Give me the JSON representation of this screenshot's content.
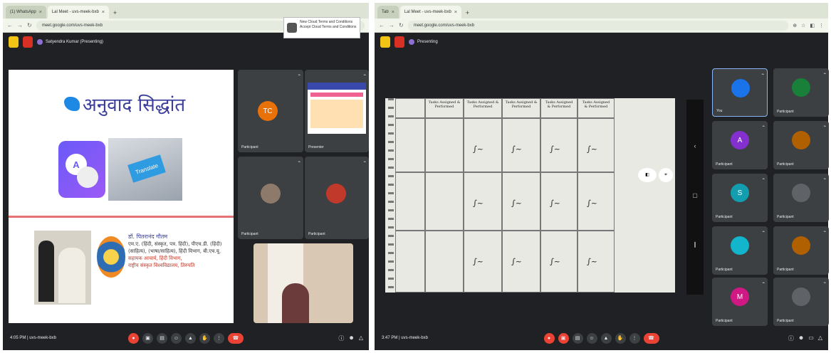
{
  "left": {
    "tabs": [
      {
        "label": "(1) WhatsApp",
        "active": false
      },
      {
        "label": "Lal Meet - uvs-meek-bxb",
        "active": true
      }
    ],
    "url": "meet.google.com/uvs-meek-bxb",
    "notification": {
      "title": "New Cloud Terms and Conditions",
      "body": "Accept Cloud Terms and Conditions"
    },
    "presenter": "Satyendra Kumar (Presenting)",
    "slide": {
      "title": "अनुवाद सिद्धांत",
      "translate_label": "Translate",
      "translate_badge": "A",
      "speaker_name": "डॉ. पितरानंद गौतम",
      "speaker_lines": [
        "एम.ए. (हिंदी, संस्कृत, पत्र. हिंदी), पीएच.डी. (हिंदी)",
        "(साहित्य), (भाषा/साहित्य), हिंदी विभाग, बी.एच.यू.",
        "सहायक आचार्य, हिंदी विभाग,",
        "राष्ट्रीय संस्कृत विश्वविद्यालय, तिरुपति"
      ]
    },
    "participants": [
      {
        "name": "Participant",
        "initials": "TC",
        "color": "#e8710a"
      },
      {
        "name": "Presenter",
        "initials": "",
        "color": ""
      },
      {
        "name": "Participant",
        "initials": "",
        "color": ""
      },
      {
        "name": "Participant",
        "initials": "",
        "color": ""
      }
    ],
    "time": "4:05 PM | uvs-meek-bxb"
  },
  "right": {
    "tabs": [
      {
        "label": "Tab",
        "active": false
      },
      {
        "label": "Lal Meet - uvs-meek-bxb",
        "active": true
      }
    ],
    "url": "meet.google.com/uvs-meek-bxb",
    "presenter": "Presenting",
    "sheet_headers": [
      "Tasks Assigned & Performed",
      "Tasks Assigned & Performed",
      "Tasks Assigned & Performed",
      "Tasks Assigned & Performed",
      "Tasks Assigned & Performed"
    ],
    "participants": [
      {
        "name": "You",
        "initials": "",
        "color": "#1a73e8"
      },
      {
        "name": "Participant",
        "initials": "",
        "color": "#188038"
      },
      {
        "name": "Participant",
        "initials": "A",
        "color": "#8430ce"
      },
      {
        "name": "Participant",
        "initials": "",
        "color": "#b06000"
      },
      {
        "name": "Participant",
        "initials": "S",
        "color": "#129eaf"
      },
      {
        "name": "Participant",
        "initials": "",
        "color": "#5f6368"
      },
      {
        "name": "Participant",
        "initials": "",
        "color": "#12b5cb"
      },
      {
        "name": "Participant",
        "initials": "",
        "color": "#b06000"
      },
      {
        "name": "Participant",
        "initials": "M",
        "color": "#d01884"
      },
      {
        "name": "Participant",
        "initials": "",
        "color": "#5f6368"
      }
    ],
    "time": "3:47 PM | uvs-meek-bxb"
  }
}
